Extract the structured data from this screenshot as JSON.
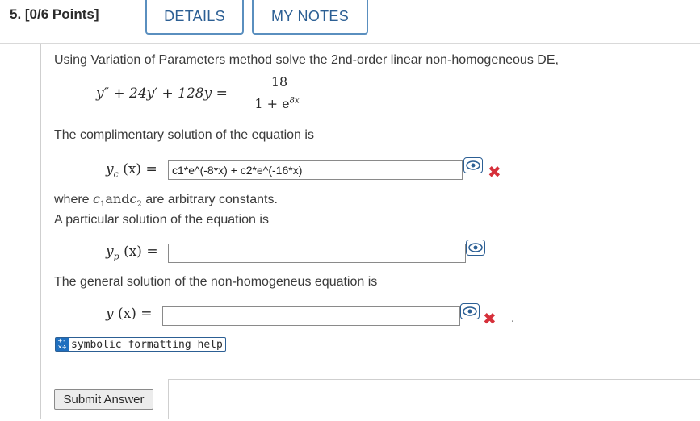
{
  "header": {
    "title": "5. [0/6 Points]",
    "details_tab": "DETAILS",
    "notes_tab": "MY NOTES"
  },
  "question": {
    "intro": "Using Variation of Parameters method solve the 2nd-order linear non-homogeneous DE,",
    "de_lhs": "y″ + 24y′ + 128y =",
    "de_num": "18",
    "de_den_base": "1 + e",
    "de_den_exp": "8x",
    "comp_text": "The complimentary solution of the equation is",
    "yc_label": "y",
    "yc_sub": "c",
    "arg": "(x) =",
    "yc_value": "c1*e^(-8*x) + c2*e^(-16*x)",
    "where_prefix": "where ",
    "c1_sym": "c",
    "c1_sub": "1",
    "and_word": "and",
    "c2_sym": "c",
    "c2_sub": "2",
    "where_suffix": " are arbitrary constants.",
    "part_text": "A particular solution of the equation is",
    "yp_label": "y",
    "yp_sub": "p",
    "yp_value": "",
    "general_text": "The general solution of the non-homogeneus equation is",
    "y_label": "y",
    "y_value": "",
    "period": "."
  },
  "icons": {
    "preview": "eye-preview-icon",
    "incorrect": "red-x-icon",
    "incorrect_symbol": "✖",
    "incorrect_color": "#d6303a"
  },
  "footer": {
    "help_label": "symbolic formatting help",
    "submit_label": "Submit Answer"
  }
}
